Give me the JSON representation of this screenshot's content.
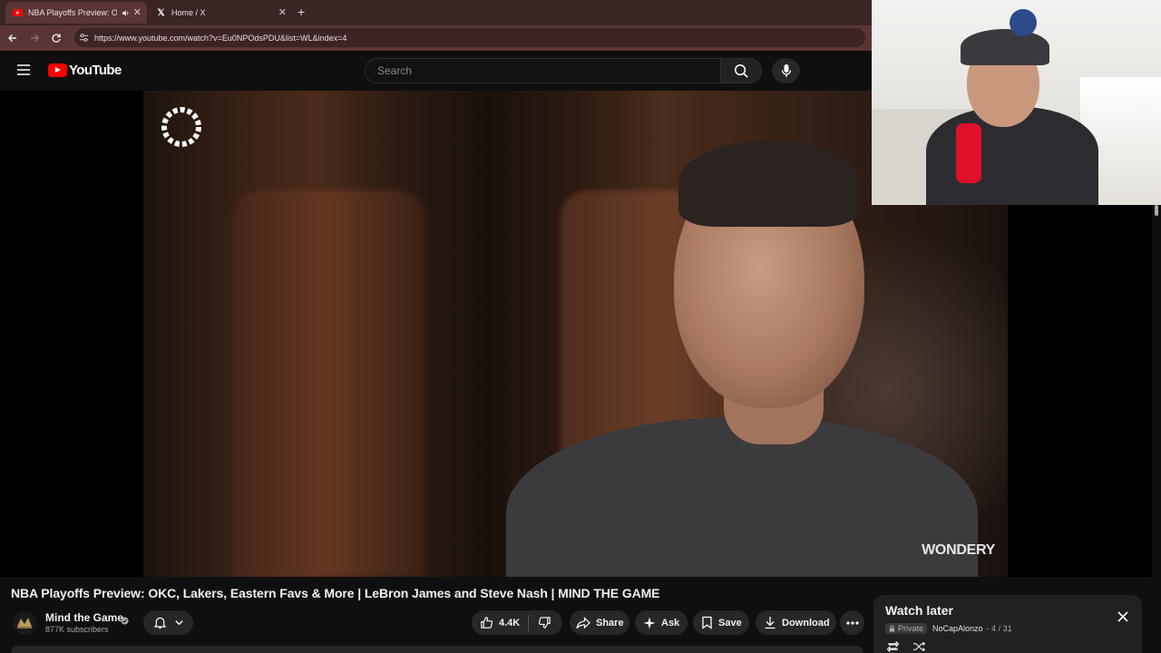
{
  "browser": {
    "tabs": [
      {
        "title": "NBA Playoffs Preview: OKC",
        "active": true
      },
      {
        "title": "Home / X",
        "active": false
      }
    ],
    "url": "https://www.youtube.com/watch?v=Eu0NPOdsPDU&list=WL&index=4"
  },
  "youtube": {
    "logo_text": "YouTube",
    "search_placeholder": "Search"
  },
  "video": {
    "title": "NBA Playoffs Preview: OKC, Lakers, Eastern Favs & More | LeBron James and Steve Nash | MIND THE GAME",
    "watermark_text": "WONDERY",
    "channel": {
      "name": "Mind the Game",
      "subscribers": "877K subscribers"
    },
    "actions": {
      "likes": "4.4K",
      "share": "Share",
      "ask": "Ask",
      "save": "Save",
      "download": "Download"
    }
  },
  "playlist": {
    "title": "Watch later",
    "privacy": "Private",
    "owner": "NoCapAlonzo",
    "position": "- 4 / 31"
  },
  "colors": {
    "tab_bar": "#3a2424",
    "address_bar": "#5a3535",
    "youtube_red": "#ff0000",
    "page_bg": "#0f0f0f",
    "pill_bg": "#272727"
  }
}
